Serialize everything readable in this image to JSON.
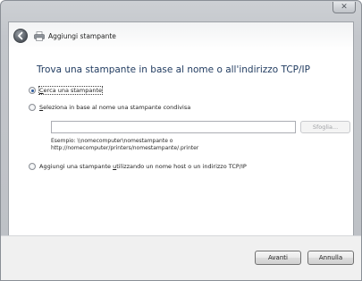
{
  "window": {
    "title": "Aggiungi stampante"
  },
  "heading": "Trova una stampante in base al nome o all'indirizzo TCP/IP",
  "options": [
    {
      "pre": "",
      "u": "C",
      "post": "erca una stampante",
      "checked": true
    },
    {
      "pre": "",
      "u": "S",
      "post": "eleziona in base al nome una stampante condivisa",
      "checked": false
    },
    {
      "pre": "Aggiungi una stampante ",
      "u": "u",
      "post": "tilizzando un nome host o un indirizzo TCP/IP",
      "checked": false
    }
  ],
  "shared_printer": {
    "value": "",
    "browse_label": "Sfoglia...",
    "example_line1": "Esempio: \\\\nomecomputer\\nomestampante o",
    "example_line2": "http://nomecomputer/printers/nomestampante/.printer"
  },
  "buttons": {
    "next": "Avanti",
    "cancel": "Annulla"
  },
  "icons": {
    "back": "back-arrow-icon",
    "printer": "printer-icon",
    "close": "close-icon"
  }
}
